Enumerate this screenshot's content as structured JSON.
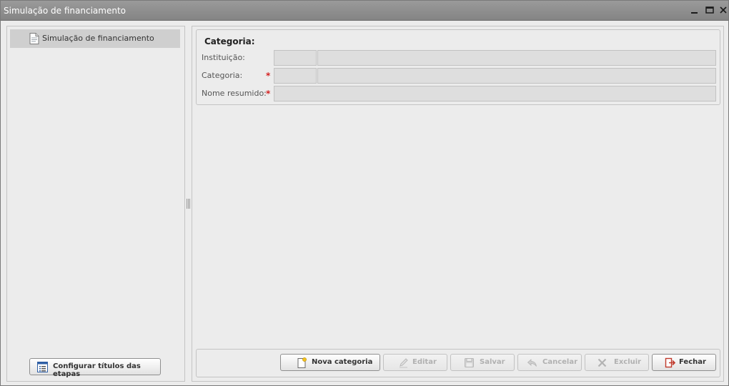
{
  "window": {
    "title": "Simulação de financiamento"
  },
  "sidebar": {
    "items": [
      {
        "label": "Simulação de financiamento",
        "icon": "document-icon",
        "selected": true
      }
    ],
    "config_button": {
      "label": "Configurar títulos das etapas",
      "icon": "list-icon"
    }
  },
  "form": {
    "section_title": "Categoria:",
    "fields": [
      {
        "label": "Instituição:",
        "required": false,
        "code_value": "",
        "desc_value": ""
      },
      {
        "label": "Categoria:",
        "required": true,
        "code_value": "",
        "desc_value": ""
      },
      {
        "label": "Nome resumido:",
        "required": true,
        "value": ""
      }
    ],
    "required_marker": "*"
  },
  "actions": {
    "new": {
      "label": "Nova categoria",
      "icon": "new-document-icon",
      "enabled": true
    },
    "edit": {
      "label": "Editar",
      "icon": "pencil-icon",
      "enabled": false
    },
    "save": {
      "label": "Salvar",
      "icon": "floppy-disk-icon",
      "enabled": false
    },
    "cancel": {
      "label": "Cancelar",
      "icon": "undo-arrow-icon",
      "enabled": false
    },
    "delete": {
      "label": "Excluir",
      "icon": "x-icon",
      "enabled": false
    },
    "close": {
      "label": "Fechar",
      "icon": "exit-door-icon",
      "enabled": true
    }
  },
  "colors": {
    "titlebar": "#8d8d8d",
    "panel_bg": "#ececec",
    "selected_item": "#cfcfcf",
    "field_bg": "#dedede",
    "required": "#d42020",
    "close_icon": "#c0392b"
  }
}
